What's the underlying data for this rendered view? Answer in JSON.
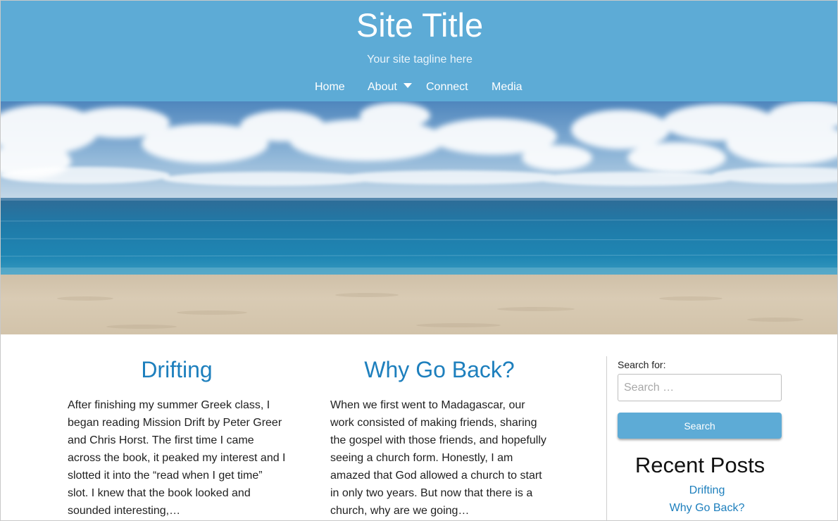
{
  "header": {
    "title": "Site Title",
    "tagline": "Your site tagline here",
    "background": "#5dabd6"
  },
  "nav": {
    "home": "Home",
    "about": "About",
    "connect": "Connect",
    "media": "Media"
  },
  "posts": [
    {
      "title": "Drifting",
      "excerpt": "After finishing my summer Greek class, I began reading Mission Drift by Peter Greer and Chris Horst. The first time I came across the book, it peaked my interest and I slotted it into the “read when I get time” slot. I knew that the book looked and sounded interesting,…"
    },
    {
      "title": "Why Go Back?",
      "excerpt": "When we first went to Madagascar, our work consisted of making friends, sharing the gospel with those friends, and hopefully seeing a church form. Honestly, I am amazed that God allowed a church to start in only two years. But now that there is a church, why are we going…"
    }
  ],
  "sidebar": {
    "search_label": "Search for:",
    "search_placeholder": "Search …",
    "search_button": "Search",
    "recent_heading": "Recent Posts",
    "recent_posts": [
      "Drifting",
      "Why Go Back?"
    ]
  },
  "colors": {
    "accent": "#5dabd6",
    "link": "#1d7fbd"
  }
}
